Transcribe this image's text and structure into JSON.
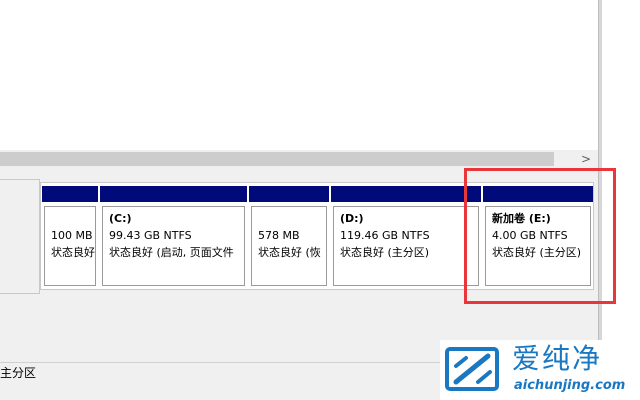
{
  "scrollbar": {
    "right_arrow": ">"
  },
  "partitions": [
    {
      "name": "",
      "size": "100 MB",
      "status": "状态良好"
    },
    {
      "name": "(C:)",
      "size": "99.43 GB NTFS",
      "status": "状态良好 (启动, 页面文件"
    },
    {
      "name": "",
      "size": "578 MB",
      "status": "状态良好 (恢"
    },
    {
      "name": "(D:)",
      "size": "119.46 GB NTFS",
      "status": "状态良好 (主分区)"
    },
    {
      "name": "新加卷  (E:)",
      "size": "4.00 GB NTFS",
      "status": "状态良好 (主分区)"
    }
  ],
  "legend": {
    "primary_partition": "主分区"
  },
  "colors": {
    "partition_bar": "#000a7a",
    "highlight": "#e8363b",
    "watermark": "#1a78c2"
  },
  "watermark": {
    "title": "爱纯净",
    "url": "aichunjing.com",
    "icon": "logo-icon"
  }
}
